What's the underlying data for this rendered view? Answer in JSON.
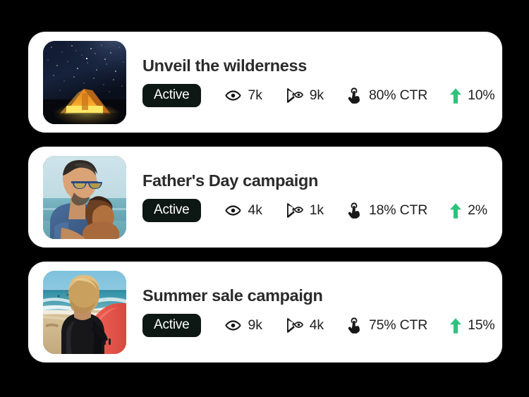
{
  "theme": {
    "background": "#000000",
    "card_background": "#ffffff",
    "title_color": "#2b2b2b",
    "badge_background": "#0d1714",
    "badge_text_color": "#ffffff",
    "metric_text_color": "#1f1f1f",
    "growth_accent": "#2ec27e"
  },
  "icons": {
    "views": "eye-icon",
    "reach": "cursor-eye-icon",
    "ctr": "tap-hand-icon",
    "growth": "arrow-up-icon"
  },
  "campaigns": [
    {
      "title": "Unveil the wilderness",
      "status": "Active",
      "thumbnail_alt": "night-sky-tent-thumbnail",
      "views": "7k",
      "reach": "9k",
      "ctr": "80% CTR",
      "growth": "10%"
    },
    {
      "title": "Father's Day campaign",
      "status": "Active",
      "thumbnail_alt": "father-and-son-beach-thumbnail",
      "views": "4k",
      "reach": "1k",
      "ctr": "18% CTR",
      "growth": "2%"
    },
    {
      "title": "Summer sale campaign",
      "status": "Active",
      "thumbnail_alt": "surfer-with-surfboard-thumbnail",
      "views": "9k",
      "reach": "4k",
      "ctr": "75% CTR",
      "growth": "15%"
    }
  ]
}
